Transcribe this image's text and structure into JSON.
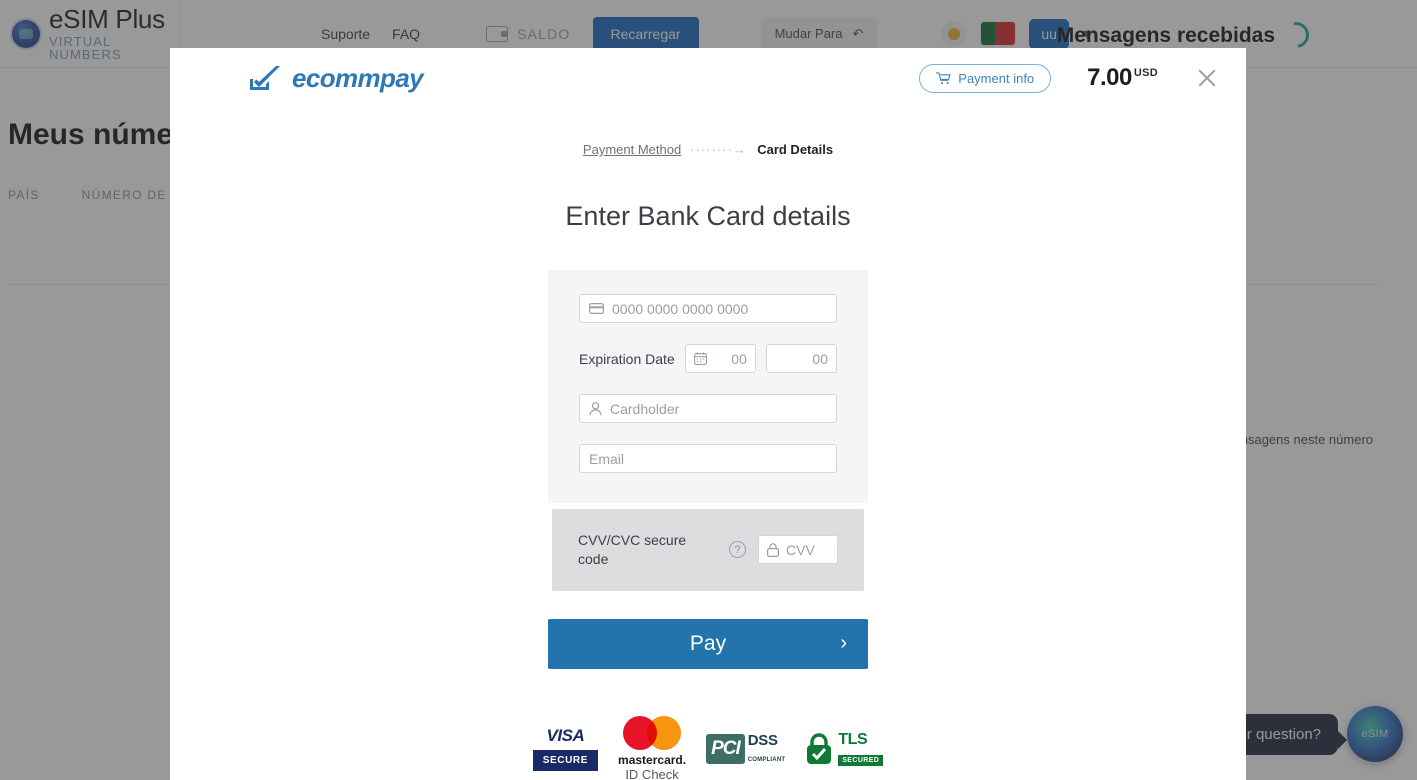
{
  "background": {
    "brand": {
      "title": "eSIM Plus",
      "subtitle": "VIRTUAL NUMBERS",
      "logo_icon": "esim-logo-icon"
    },
    "nav": {
      "support_label": "Suporte",
      "faq_label": "FAQ",
      "balance_label": "SALDO",
      "recharge_label": "Recarregar",
      "switch_label": "Mudar Para",
      "theme_icon": "sun-icon",
      "flag_icon": "portugal-flag-icon",
      "avatar_label": "uu",
      "chevron_icon": "chevron-down-icon"
    },
    "page_title": "Meus números",
    "table_headers": [
      "PAÍS",
      "NÚMERO DE TELEFONE"
    ],
    "inbox_title": "Mensagens recebidas",
    "inbox_note": "ensagens neste número",
    "chat": {
      "bubble_text": "r question?",
      "avatar_label": "eSIM"
    }
  },
  "modal": {
    "logo_text": "ecommpay",
    "logo_icon": "ecommpay-checkmark-icon",
    "payment_info_label": "Payment info",
    "payment_info_icon": "cart-icon",
    "amount": "7.00",
    "currency": "USD",
    "close_icon": "close-icon",
    "breadcrumb": {
      "previous_label": "Payment Method",
      "separator": "·········",
      "current_label": "Card Details"
    },
    "title": "Enter Bank Card details",
    "form": {
      "card_number_placeholder": "0000 0000 0000 0000",
      "card_number_icon": "credit-card-icon",
      "expiration_label": "Expiration Date",
      "expiration_icon": "calendar-icon",
      "expiration_month_placeholder": "00",
      "expiration_year_placeholder": "00",
      "cardholder_placeholder": "Cardholder",
      "cardholder_icon": "person-icon",
      "email_placeholder": "Email"
    },
    "cvv": {
      "label": "CVV/CVC secure code",
      "help_icon": "help-icon",
      "lock_icon": "lock-icon",
      "placeholder": "CVV"
    },
    "pay_button": {
      "label": "Pay",
      "chevron": "›"
    },
    "badges": {
      "visa_top": "VISA",
      "visa_bottom": "SECURE",
      "mastercard_top": "mastercard.",
      "mastercard_bottom": "ID Check",
      "pci_mark": "PCI",
      "pci_dss": "DSS",
      "pci_sub": "COMPLIANT",
      "tls_top": "TLS",
      "tls_bottom": "SECURED"
    }
  },
  "colors": {
    "accent_blue": "#2374ac",
    "brand_blue": "#1565c0",
    "ecommpay_blue": "#2e79b5",
    "panel_gray": "#f4f5f6",
    "cvv_gray": "#dcdddf"
  }
}
